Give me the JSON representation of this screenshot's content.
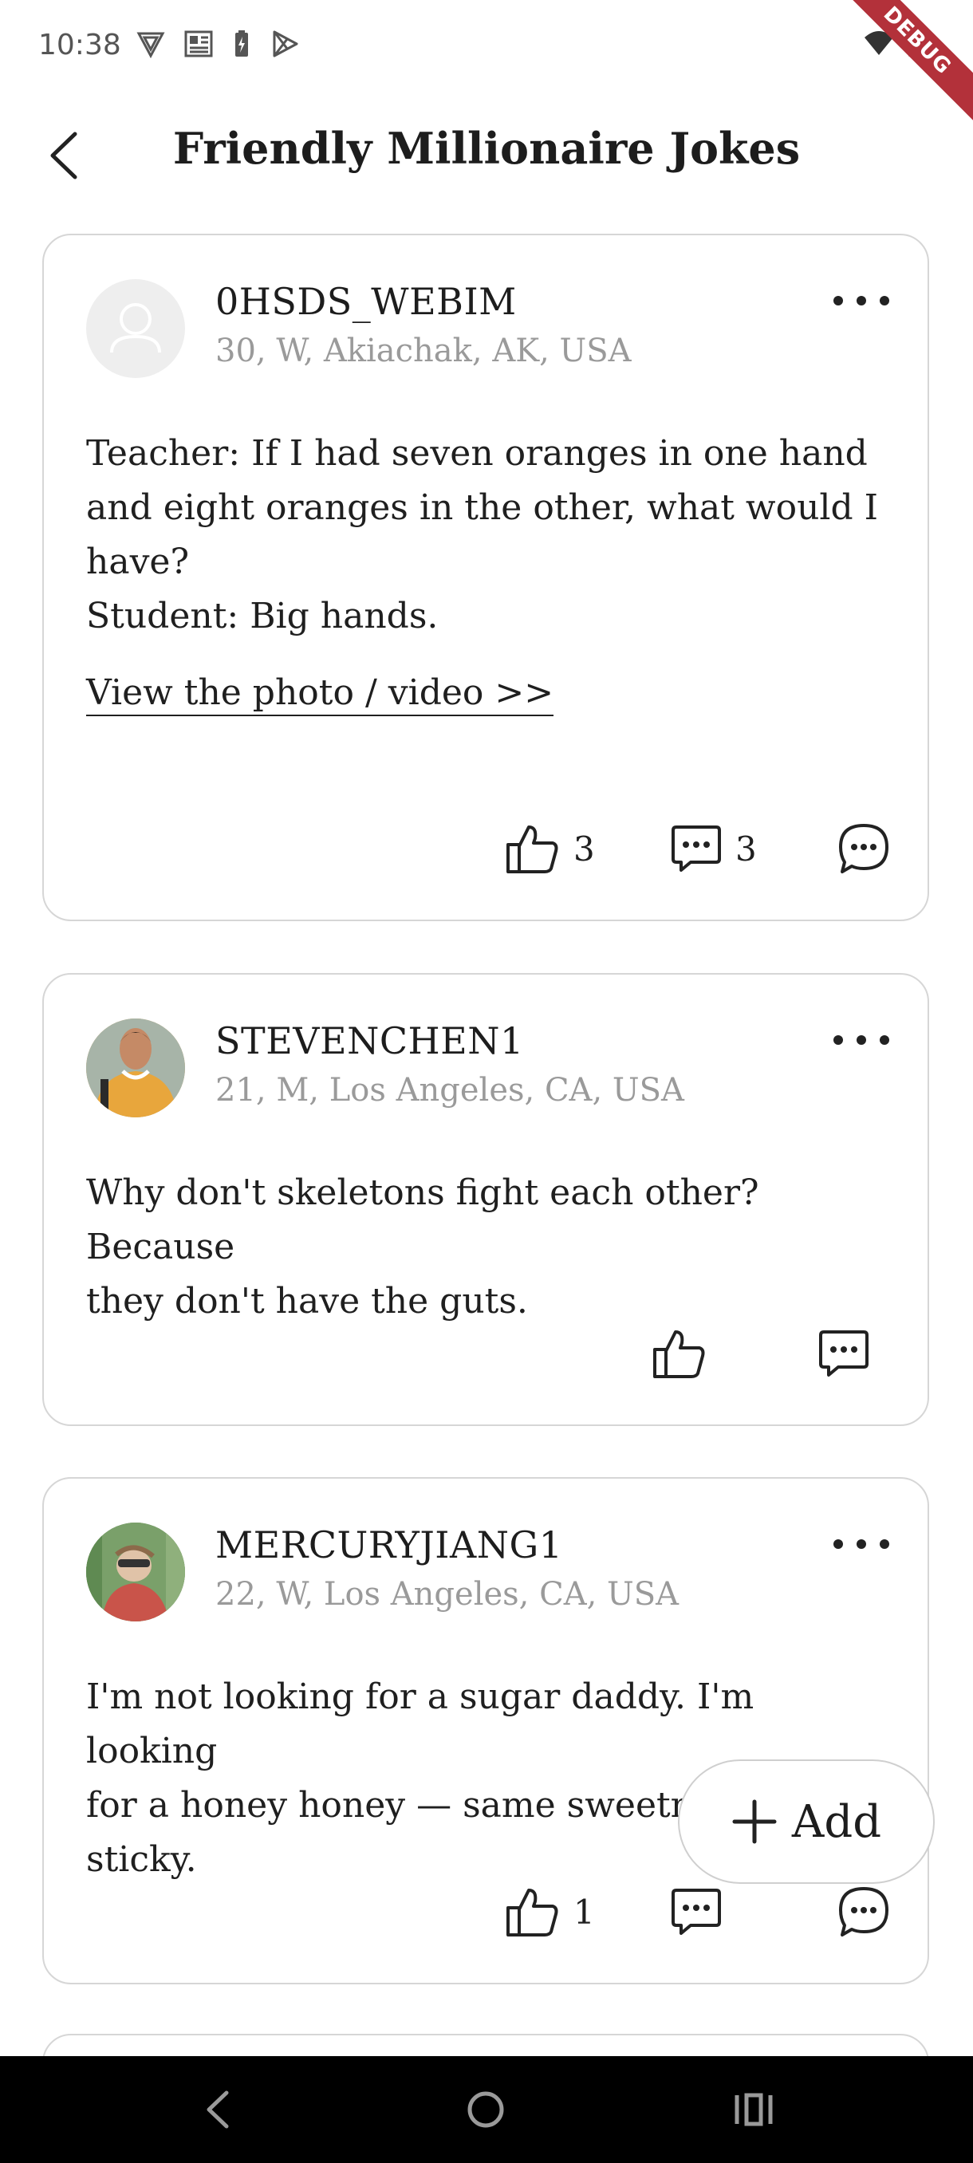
{
  "status_bar": {
    "time": "10:38",
    "debug_label": "DEBUG"
  },
  "header": {
    "title": "Friendly Millionaire Jokes"
  },
  "posts": [
    {
      "username": "0HSDS_WEBIM",
      "meta": "30, W, Akiachak, AK, USA",
      "text": "Teacher: If I had seven oranges in one hand\nand eight oranges in the other, what would I\nhave?\nStudent: Big hands.",
      "media_link": "View the photo / video >>",
      "like_count": "3",
      "comment_count": "3"
    },
    {
      "username": "STEVENCHEN1",
      "meta": "21, M, Los Angeles, CA, USA",
      "text": "Why don't skeletons fight each other?Because\nthey don't have the guts."
    },
    {
      "username": "MERCURYJIANG1",
      "meta": "22, W, Los Angeles, CA, USA",
      "text": "I'm not looking for a sugar daddy. I'm looking\nfor a honey honey — same sweetness, less\nsticky.",
      "like_count": "1"
    }
  ],
  "fab": {
    "label": "Add"
  },
  "colors": {
    "card_border": "#d6d6d6",
    "meta_text": "#9a9a9a",
    "debug_ribbon": "#b3313a",
    "nav_bar": "#000000"
  }
}
